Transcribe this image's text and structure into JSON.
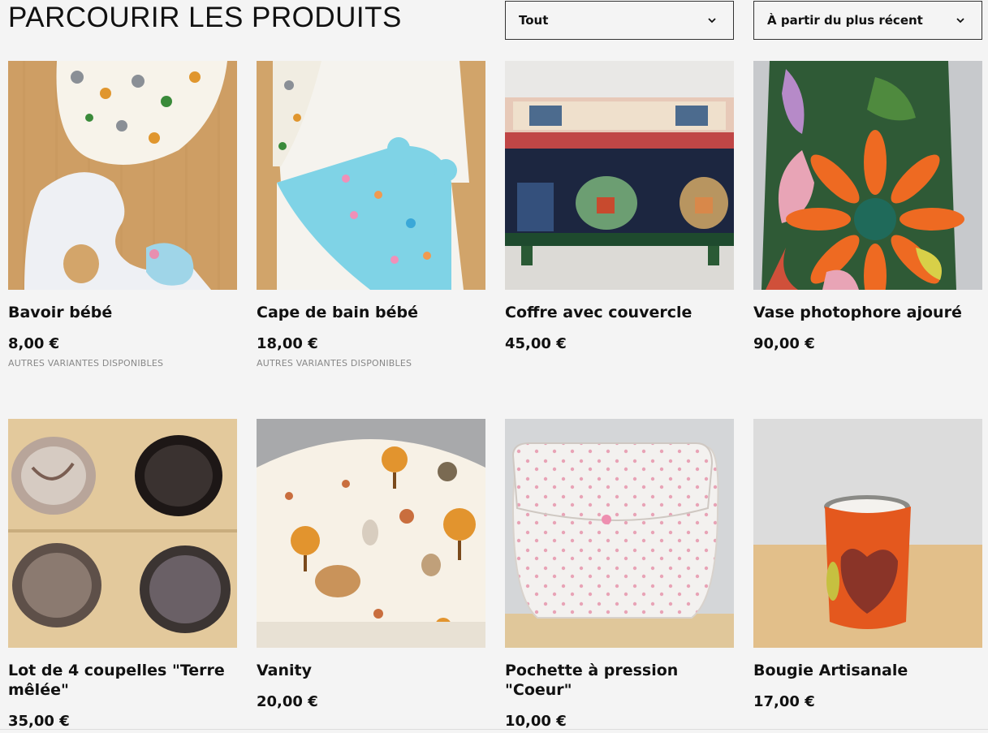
{
  "header": {
    "title": "PARCOURIR LES PRODUITS",
    "category_select": {
      "value": "Tout"
    },
    "sort_select": {
      "value": "À partir du plus récent"
    }
  },
  "products": [
    {
      "name": "Bavoir bébé",
      "price": "8,00 €",
      "variants": "AUTRES VARIANTES DISPONIBLES"
    },
    {
      "name": "Cape de bain bébé",
      "price": "18,00 €",
      "variants": "AUTRES VARIANTES DISPONIBLES"
    },
    {
      "name": "Coffre avec couvercle",
      "price": "45,00 €",
      "variants": ""
    },
    {
      "name": "Vase photophore ajouré",
      "price": "90,00 €",
      "variants": ""
    },
    {
      "name": "Lot de 4 coupelles \"Terre mêlée\"",
      "price": "35,00 €",
      "variants": ""
    },
    {
      "name": "Vanity",
      "price": "20,00 €",
      "variants": ""
    },
    {
      "name": "Pochette à pression \"Coeur\"",
      "price": "10,00 €",
      "variants": ""
    },
    {
      "name": "Bougie Artisanale",
      "price": "17,00 €",
      "variants": ""
    }
  ],
  "icons": {
    "dropdown": "chevron-down-icon"
  }
}
